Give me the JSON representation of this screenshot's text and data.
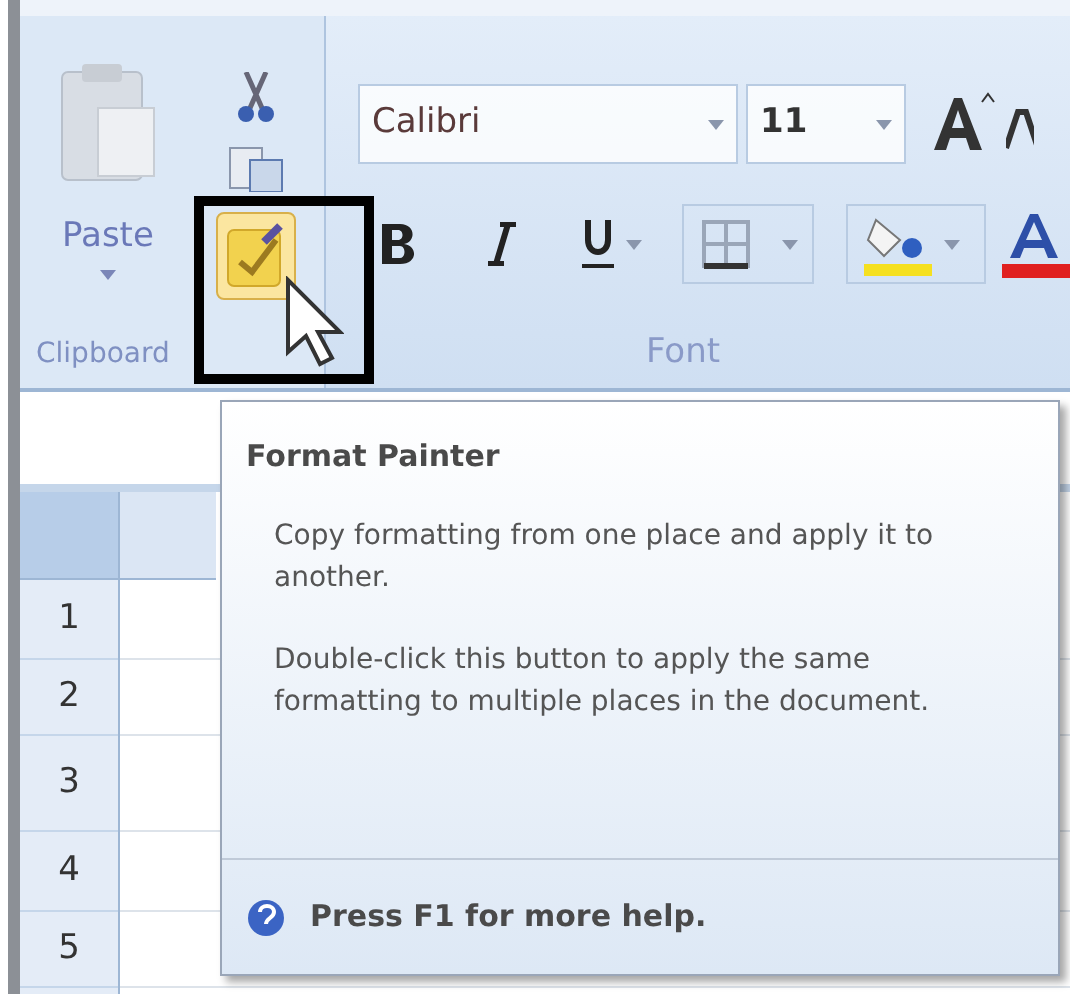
{
  "clipboard": {
    "paste_label": "Paste",
    "group_label": "Clipboard",
    "format_painter": {
      "highlighted": true
    }
  },
  "font": {
    "font_name": "Calibri",
    "font_size": "11",
    "group_label": "Font"
  },
  "row_headers": [
    "1",
    "2",
    "3",
    "4",
    "5"
  ],
  "tooltip": {
    "title": "Format Painter",
    "paragraphs": [
      "Copy formatting from one place and apply it to another.",
      "Double-click this button to apply the same formatting to multiple places in the document."
    ],
    "footer": "Press F1 for more help."
  }
}
